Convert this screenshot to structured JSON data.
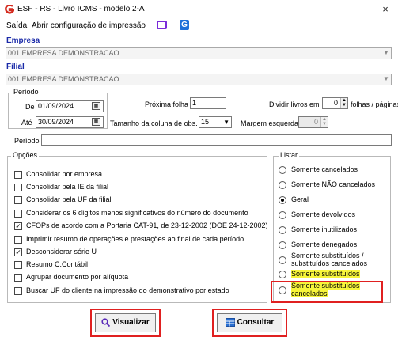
{
  "window": {
    "title": "ESF - RS - Livro ICMS - modelo 2-A",
    "close": "×"
  },
  "menu": {
    "items": [
      "Saída",
      "Abrir configuração de impressão"
    ]
  },
  "colors": {
    "brand_red": "#d42a1e",
    "section_blue": "#1a2aa8",
    "highlight": "#f7f53b",
    "annotation": "#e02020",
    "purple_icon": "#7a2bd8",
    "blue_icon": "#1e6fd9"
  },
  "empresa": {
    "label": "Empresa",
    "value": "001 EMPRESA DEMONSTRACAO"
  },
  "filial": {
    "label": "Filial",
    "value": "001 EMPRESA DEMONSTRACAO"
  },
  "periodo_group": {
    "title": "Período",
    "de_label": "De",
    "de_value": "01/09/2024",
    "ate_label": "Até",
    "ate_value": "30/09/2024",
    "proxima_folha_label": "Próxima folha",
    "proxima_folha_value": "1",
    "dividir_label": "Dividir livros em",
    "dividir_value": "0",
    "folhas_label": "folhas / páginas",
    "tamanho_label": "Tamanho da coluna de obs.",
    "tamanho_value": "15",
    "margem_label": "Margem esquerda",
    "margem_value": "0"
  },
  "periodo_field": {
    "label": "Período",
    "value": ""
  },
  "opcoes": {
    "title": "Opções",
    "items": [
      {
        "label": "Consolidar por empresa",
        "checked": false
      },
      {
        "label": "Consolidar pela IE da filial",
        "checked": false
      },
      {
        "label": "Consolidar pela UF da filial",
        "checked": false
      },
      {
        "label": "Considerar os 6 dígitos menos significativos do número do documento",
        "checked": false
      },
      {
        "label": "CFOPs de acordo com a Portaria CAT-91, de 23-12-2002 (DOE 24-12-2002)",
        "checked": true
      },
      {
        "label": "Imprimir resumo de operações e prestações ao final de cada período",
        "checked": false
      },
      {
        "label": "Desconsiderar série U",
        "checked": true
      },
      {
        "label": "Resumo C.Contábil",
        "checked": false
      },
      {
        "label": "Agrupar documento por alíquota",
        "checked": false
      },
      {
        "label": "Buscar UF do cliente na impressão do demonstrativo por estado",
        "checked": false
      }
    ]
  },
  "listar": {
    "title": "Listar",
    "items": [
      {
        "label": "Somente cancelados",
        "selected": false
      },
      {
        "label": "Somente NÃO cancelados",
        "selected": false
      },
      {
        "label": "Geral",
        "selected": true
      },
      {
        "label": "Somente devolvidos",
        "selected": false
      },
      {
        "label": "Somente inutilizados",
        "selected": false
      },
      {
        "label": "Somente denegados",
        "selected": false
      },
      {
        "label": "Somente substituídos / substituídos cancelados",
        "label_lines": [
          "Somente substituídos /",
          "substituídos cancelados"
        ],
        "selected": false
      },
      {
        "label": "Somente substituídos",
        "selected": false
      },
      {
        "label": "Somente substituídos cancelados",
        "label_lines": [
          "Somente substituídos",
          "cancelados"
        ],
        "selected": false
      }
    ]
  },
  "buttons": {
    "visualizar": "Visualizar",
    "consultar": "Consultar"
  }
}
